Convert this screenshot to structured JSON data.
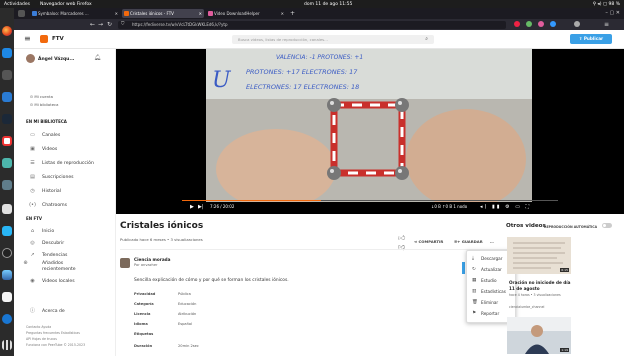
{
  "topbar": {
    "activities": "Actividades",
    "app_name": "Navegador web Firefox",
    "clock": "dom 11 de ago  11:55",
    "tray": "⚲  ◂)  ▢ 98 %"
  },
  "tabs": [
    {
      "label": "Symbaloo: Marcadores ...",
      "icon_color": "#3b7dd8"
    },
    {
      "label": "Cristales iónicos - FTV",
      "icon_color": "#f2690d"
    },
    {
      "label": "Video DownloadHelper",
      "icon_color": "#e05d9d"
    }
  ],
  "browser": {
    "url": "https://fediverse.tv/w/vVcLTtDGkWKLEd6,k/?ytp",
    "back": "←",
    "forward": "→",
    "reload": "↻",
    "new_tab": "+",
    "window_controls": "–  ▢  ✕"
  },
  "header": {
    "site_name": "FTV",
    "search_placeholder": "Busca videos, listas de reproducción, canales…",
    "publish_label": "⇪ Publicar"
  },
  "sidebar": {
    "user_name": "Ángel Vázqu...",
    "my_account": "Mi cuenta",
    "my_library": "Mi biblioteca",
    "section_library": "EN MI BIBLIOTECA",
    "items_library": [
      {
        "label": "Canales",
        "icon": "folder-icon",
        "glyph": "▭"
      },
      {
        "label": "Videos",
        "icon": "video-icon",
        "glyph": "▣"
      },
      {
        "label": "Listas de reproducción",
        "icon": "list-icon",
        "glyph": "☰"
      },
      {
        "label": "Suscripciones",
        "icon": "inbox-icon",
        "glyph": "▤"
      },
      {
        "label": "Historial",
        "icon": "history-icon",
        "glyph": "◷"
      },
      {
        "label": "Chatrooms",
        "icon": "chat-icon",
        "glyph": "(•)"
      }
    ],
    "section_ftv": "EN FTV",
    "items_ftv": [
      {
        "label": "Inicio",
        "icon": "home-icon",
        "glyph": "⌂"
      },
      {
        "label": "Descubrir",
        "icon": "globe-icon",
        "glyph": "◎"
      },
      {
        "label": "Tendencias",
        "icon": "trending-icon",
        "glyph": "↗"
      },
      {
        "label": "Añadidos recientemente",
        "icon": "plus-icon",
        "glyph": "⊕"
      },
      {
        "label": "Videos locales",
        "icon": "local-icon",
        "glyph": "◉"
      }
    ],
    "about": "Acerca de",
    "footer_line1": "Contacto  Ayuda",
    "footer_line2": "Preguntas frecuentes  Estadísticas",
    "footer_line3": "API  Hojas de trucos",
    "footer_line4": "Funciona con PeerTube © 2015-2023"
  },
  "player": {
    "time": "7:26 / 20:02",
    "stats": "↓0 B  ↑0 B  1 nodo",
    "progress": 0.37,
    "board_lines": [
      "VALENCIA: -1 PROTONES: +1",
      "PROTONES: +17  ELECTRONES: 17",
      "ELECTRONES: 17  ELECTRONES: 18"
    ]
  },
  "video": {
    "title": "Cristales iónicos",
    "meta": "Publicado hace 6 meses • 3 visualizaciones",
    "like_count": "0",
    "dislike_count": "0",
    "share_label": "COMPARTIR",
    "save_label": "GUARDAR",
    "more_label": "…",
    "channel_name": "Ciencia morada",
    "channel_by": "Por anvazher",
    "description": "Sencilla explicación de cómo y por qué se forman los cristales iónicos.",
    "attributes": [
      {
        "key": "Privacidad",
        "value": "Pública"
      },
      {
        "key": "Categoría",
        "value": "Educación"
      },
      {
        "key": "Licencia",
        "value": "Atribución"
      },
      {
        "key": "Idioma",
        "value": "Español"
      },
      {
        "key": "Etiquetas",
        "value": ""
      },
      {
        "key": "Duración",
        "value": "20min 2sec"
      }
    ]
  },
  "dropdown": [
    {
      "label": "Descargar",
      "icon": "download-icon",
      "glyph": "⤓"
    },
    {
      "label": "Actualizar",
      "icon": "refresh-icon",
      "glyph": "↻"
    },
    {
      "label": "Estudio",
      "icon": "studio-icon",
      "glyph": "▦"
    },
    {
      "label": "Estadísticas",
      "icon": "stats-icon",
      "glyph": "▥"
    },
    {
      "label": "Eliminar",
      "icon": "trash-icon",
      "glyph": "🗑"
    },
    {
      "label": "Reportar",
      "icon": "flag-icon",
      "glyph": "⚑"
    }
  ],
  "other_videos": {
    "heading": "Otros videos",
    "autoplay_label": "REPRODUCCIÓN AUTOMÁTICA",
    "items": [
      {
        "title": "Oración no iniciode de día 11 de agosto",
        "meta1": "hace 4 horas • 3 visualizaciones",
        "meta2": "ciencialumbe_channel",
        "duration": "6:15"
      },
      {
        "title": "",
        "meta1": "",
        "meta2": "",
        "duration": "1:19"
      }
    ]
  }
}
